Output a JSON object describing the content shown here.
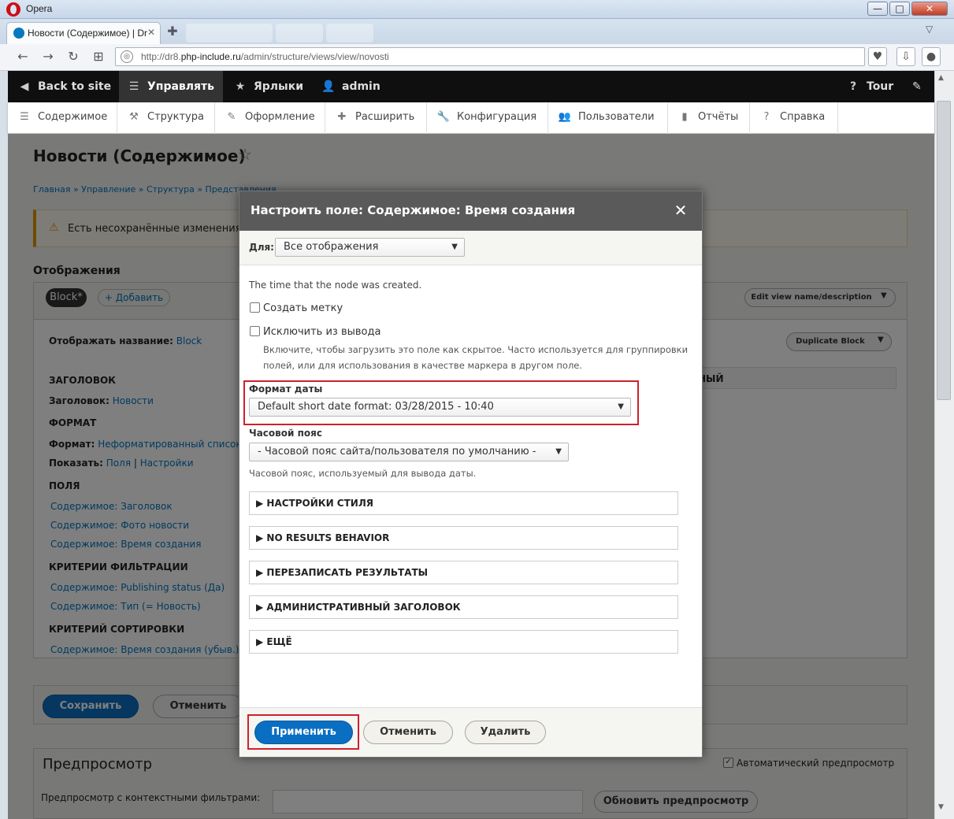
{
  "browser": {
    "app_name": "Opera",
    "tab_title": "Новости (Содержимое) | Dr",
    "url_prefix": "http://dr8.",
    "url_host": "php-include.ru",
    "url_path": "/admin/structure/views/view/novosti",
    "win_minimize": "—",
    "win_maximize": "□",
    "win_close": "✕"
  },
  "toolbar": {
    "back": "Back to site",
    "manage": "Управлять",
    "shortcuts": "Ярлыки",
    "user": "admin",
    "tour": "Tour"
  },
  "tray": [
    {
      "label": "Содержимое",
      "icon": "content-icon"
    },
    {
      "label": "Структура",
      "icon": "structure-icon"
    },
    {
      "label": "Оформление",
      "icon": "appearance-icon"
    },
    {
      "label": "Расширить",
      "icon": "extend-icon"
    },
    {
      "label": "Конфигурация",
      "icon": "configuration-icon"
    },
    {
      "label": "Пользователи",
      "icon": "people-icon"
    },
    {
      "label": "Отчёты",
      "icon": "reports-icon"
    },
    {
      "label": "Справка",
      "icon": "help-icon"
    }
  ],
  "page": {
    "title": "Новости (Содержимое)",
    "star": "☆",
    "breadcrumb": "Главная » Управление » Структура » Представления",
    "warning": "Есть несохранённые изменения.",
    "displays_title": "Отображения",
    "block_tab": "Block*",
    "add_display": "+ Добавить",
    "edit_view_btn": "Edit view name/description",
    "duplicate_btn": "Duplicate Block",
    "display_title_label": "Отображать название:",
    "display_title_value": "Block",
    "header_section": "ЗАГОЛОВОК",
    "header_label": "Заголовок:",
    "header_value": "Новости",
    "format_section": "ФОРМАТ",
    "format_label": "Формат:",
    "format_value": "Неформатированный список",
    "show_label": "Показать:",
    "show_fields": "Поля",
    "show_settings": "Настройки",
    "fields_section": "ПОЛЯ",
    "fields": [
      "Содержимое: Заголовок",
      "Содержимое: Фото новости",
      "Содержимое: Время создания"
    ],
    "filter_section": "КРИТЕРИИ ФИЛЬТРАЦИИ",
    "filters": [
      "Содержимое: Publishing status (Да)",
      "Содержимое: Тип (= Новость)"
    ],
    "sort_section": "КРИТЕРИЙ СОРТИРОВКИ",
    "sorts": [
      "Содержимое: Время создания (убыв.)"
    ],
    "right_heading_fragment": "НЫЙ",
    "save_btn": "Сохранить",
    "cancel_btn": "Отменить",
    "preview_title": "Предпросмотр",
    "auto_preview": "Автоматический предпросмотр",
    "preview_filters_label": "Предпросмотр с контекстными фильтрами:",
    "update_preview_btn": "Обновить предпросмотр"
  },
  "modal": {
    "title": "Настроить поле: Содержимое: Время создания",
    "close": "✕",
    "for_label": "Для:",
    "for_value": "Все отображения",
    "description": "The time that the node was created.",
    "create_label": "Создать метку",
    "exclude_label": "Исключить из вывода",
    "exclude_desc_1": "Включите, чтобы загрузить это поле как скрытое. Часто используется для группировки",
    "exclude_desc_2": "полей, или для использования в качестве маркера в другом поле.",
    "date_format_label": "Формат даты",
    "date_format_value": "Default short date format: 03/28/2015 - 10:40",
    "timezone_label": "Часовой пояс",
    "timezone_value": "- Часовой пояс сайта/пользователя по умолчанию -",
    "timezone_desc": "Часовой пояс, используемый для вывода даты.",
    "sections": [
      "НАСТРОЙКИ СТИЛЯ",
      "NO RESULTS BEHAVIOR",
      "ПЕРЕЗАПИСАТЬ РЕЗУЛЬТАТЫ",
      "АДМИНИСТРАТИВНЫЙ ЗАГОЛОВОК",
      "ЕЩЁ"
    ],
    "apply_btn": "Применить",
    "cancel_btn": "Отменить",
    "delete_btn": "Удалить"
  },
  "colors": {
    "primary": "#0a6fc2",
    "highlight": "#d0202b",
    "link": "#0074bd",
    "toolbar": "#0f0f0f"
  }
}
